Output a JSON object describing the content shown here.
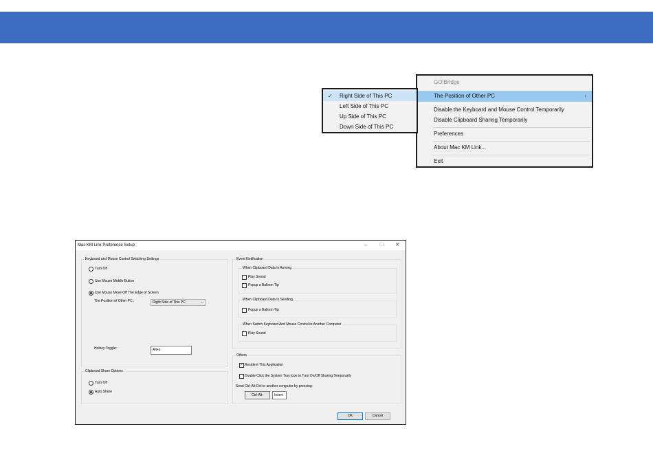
{
  "context_menu": {
    "app_name": "GO!Bridge",
    "items": [
      {
        "label": "The Position of Other PC",
        "arrow": "›"
      },
      {
        "label": "Disable the Keyboard and Mouse Control Temporarily"
      },
      {
        "label": "Disable Clipboard Sharing Temporarily"
      },
      {
        "label": "Preferences"
      },
      {
        "label": "About Mac KM Link..."
      },
      {
        "label": "Exit"
      }
    ]
  },
  "submenu": {
    "check": "✓",
    "items": [
      {
        "label": "Right Side of This PC",
        "checked": true
      },
      {
        "label": "Left Side of This PC",
        "checked": false
      },
      {
        "label": "Up Side of This PC",
        "checked": false
      },
      {
        "label": "Down Side of This PC",
        "checked": false
      }
    ]
  },
  "dialog": {
    "title": "Mac KM Link Preference Setup",
    "controls": {
      "minimize": "–",
      "maximize": "☐",
      "close": "✕"
    },
    "switching": {
      "legend": "Keyboard and Mouse Control Switching Settings",
      "turn_off": "Turn Off",
      "middle_button": "Use Mouse Middle Button",
      "edge": "Use Mouse Move Off The Edge of Screen",
      "position_label": "The Position of Other PC :",
      "position_value": "Right Side of This PC",
      "hotkey_label": "Hotkey Toggle:",
      "hotkey_value": "Alt+s"
    },
    "clipboard": {
      "legend": "Clipboard Share Options",
      "turn_off": "Turn Off",
      "auto_share": "Auto Share"
    },
    "event": {
      "legend": "Event Notification",
      "arriving": {
        "legend": "When Clipboard Data Is Arriving",
        "play_sound": "Play Sound",
        "balloon": "Popup a Balloon Tip"
      },
      "sending": {
        "legend": "When Clipboard Data Is Sending",
        "balloon": "Popup a Balloon Tip"
      },
      "switch": {
        "legend": "When Switch Keyboard And Mouse Control to Another Computer",
        "play_sound": "Play Sound"
      }
    },
    "others": {
      "legend": "Others",
      "resident": "Resident This Application",
      "resident_mark": "✓",
      "double_click": "Double Click the System Tray Icon to Turn On/Off Sharing Temporarily",
      "send_label": "Send Ctrl-Alt-Del to another computer by pressing:",
      "combo_prefix": "Ctrl-Alt-",
      "combo_key": "Insert"
    },
    "ok": "OK",
    "cancel": "Cancel"
  }
}
